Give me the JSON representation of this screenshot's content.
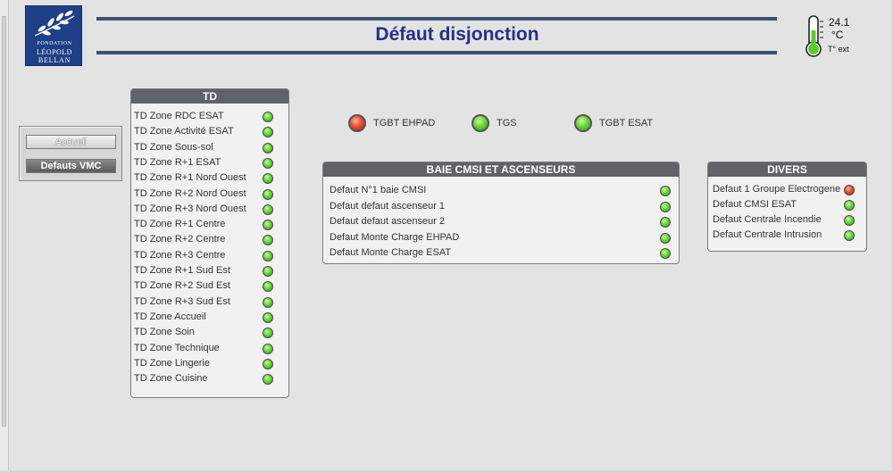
{
  "header": {
    "logo": {
      "line1": "FONDATION",
      "line2": "LÉOPOLD",
      "line3": "BELLAN"
    },
    "title": "Défaut disjonction",
    "temperature": {
      "value": "24.1",
      "unit": "°C",
      "label": "T° ext"
    }
  },
  "nav": {
    "accueil_label": "Accueil",
    "vmc_label": "Defauts VMC"
  },
  "td_panel": {
    "title": "TD",
    "items": [
      {
        "label": "TD Zone RDC ESAT",
        "status": "green"
      },
      {
        "label": "TD Zone Activité ESAT",
        "status": "green"
      },
      {
        "label": "TD Zone Sous-sol",
        "status": "green"
      },
      {
        "label": "TD Zone R+1 ESAT",
        "status": "green"
      },
      {
        "label": "TD Zone R+1 Nord Ouest",
        "status": "green"
      },
      {
        "label": "TD Zone R+2 Nord Ouest",
        "status": "green"
      },
      {
        "label": "TD Zone R+3 Nord Ouest",
        "status": "green"
      },
      {
        "label": "TD Zone R+1 Centre",
        "status": "green"
      },
      {
        "label": "TD Zone R+2 Centre",
        "status": "green"
      },
      {
        "label": "TD Zone R+3 Centre",
        "status": "green"
      },
      {
        "label": "TD Zone R+1 Sud Est",
        "status": "green"
      },
      {
        "label": "TD Zone R+2 Sud Est",
        "status": "green"
      },
      {
        "label": "TD Zone R+3 Sud Est",
        "status": "green"
      },
      {
        "label": "TD Zone Accueil",
        "status": "green"
      },
      {
        "label": "TD Zone Soin",
        "status": "green"
      },
      {
        "label": "TD Zone Technique",
        "status": "green"
      },
      {
        "label": "TD Zone Lingerie",
        "status": "green"
      },
      {
        "label": "TD Zone Cuisine",
        "status": "green"
      }
    ]
  },
  "tgbt": [
    {
      "label": "TGBT EHPAD",
      "status": "red"
    },
    {
      "label": "TGS",
      "status": "green"
    },
    {
      "label": "TGBT ESAT",
      "status": "green"
    }
  ],
  "baie_panel": {
    "title": "BAIE CMSI ET ASCENSEURS",
    "items": [
      {
        "label": "Defaut N°1 baie CMSI",
        "status": "green"
      },
      {
        "label": "Defaut defaut ascenseur 1",
        "status": "green"
      },
      {
        "label": "Defaut defaut ascenseur 2",
        "status": "green"
      },
      {
        "label": "Defaut Monte Charge EHPAD",
        "status": "green"
      },
      {
        "label": "Defaut Monte Charge ESAT",
        "status": "green"
      }
    ]
  },
  "divers_panel": {
    "title": "DIVERS",
    "items": [
      {
        "label": "Defaut 1 Groupe Electrogene",
        "status": "red"
      },
      {
        "label": "Defaut CMSI ESAT",
        "status": "green"
      },
      {
        "label": "Defaut Centrale Incendie",
        "status": "green"
      },
      {
        "label": "Defaut Centrale Intrusion",
        "status": "green"
      }
    ]
  },
  "colors": {
    "ok": "#5cc832",
    "fault": "#e04a2a",
    "title": "#25308a",
    "panel_header": "#5f6368",
    "logo_bg": "#1f3f87"
  }
}
